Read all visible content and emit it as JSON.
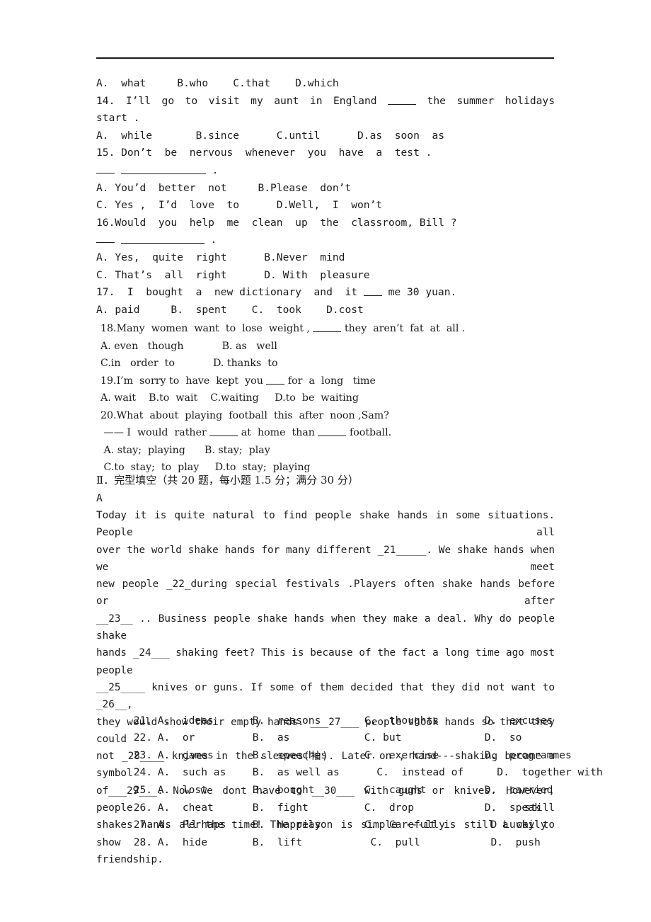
{
  "document": {
    "type": "english-exam-paper",
    "rule_visible": true
  },
  "grammar_section": {
    "q13_options_line": "A.  what     B.who    C.that    D.which",
    "q14": {
      "stem_line1": "14.  I’ll  go  to  visit  my  aunt  in  England",
      "stem_blank": "_____",
      "stem_line1_tail": "the  summer  holidays",
      "stem_line2": "start .",
      "options": "A.  while       B.since      C.until      D.as  soon  as"
    },
    "q15": {
      "stem": "15. Don’t  be  nervous  whenever  you  have  a  test .",
      "answer_line_suffix": ".",
      "options_line1": "A. You’d  better  not     B.Please  don’t",
      "options_line2": "C. Yes ,  I’d  love  to      D.Well,  I  won’t"
    },
    "q16": {
      "stem": "16.Would  you  help  me  clean  up  the  classroom, Bill ?",
      "answer_line_suffix": ".",
      "options_line1": "A. Yes,  quite  right      B.Never  mind",
      "options_line2": "C. That’s  all  right      D. With  pleasure"
    },
    "q17": {
      "stem_pre": "17.  I  bought  a  new dictionary  and  it",
      "stem_post": "me 30 yuan.",
      "options": "A. paid     B.  spent    C.  took    D.cost"
    },
    "q18": {
      "stem_pre": "18.Many  women  want  to  lose  weight ,",
      "stem_post": "they  aren’t  fat  at  all .",
      "options_line1": "A. even   though            B. as   well",
      "options_line2": "C.in   order  to            D. thanks  to"
    },
    "q19": {
      "stem_pre": "19.I’m  sorry to  have  kept  you",
      "stem_post": "for  a  long   time",
      "options": "A. wait    B.to  wait    C.waiting     D.to  be  waiting"
    },
    "q20": {
      "stem": "20.What  about  playing  football  this  after  noon ,Sam?",
      "answer_pre": "—— I  would  rather",
      "answer_mid": "at  home  than",
      "answer_post": "football.",
      "options_line1": " A. stay;  playing      B. stay;  play",
      "options_line2": " C.to  stay;  to  play     D.to  stay;  playing"
    }
  },
  "cloze_section": {
    "heading": "Ⅱ．完型填空（共 20 题，每小题 1.5 分；满分 30 分）",
    "sub_label": "A",
    "passage_lines": [
      "Today it is quite natural to find people shake hands in some situations. People all",
      "over the world shake hands for many different _21_____. We shake hands when we meet",
      "new people _22_during special festivals .Players often shake hands before or after",
      "__23__ .. Business people shake hands when they make a deal. Why do people shake",
      "hands _24___ shaking feet? This is because of the fact a long time ago most people",
      "__25____ knives or guns.  If some of them decided that they did not want to _26__,",
      "they would show their empty hands. ___27___ people shook hands so that they could",
      "not _28____  knives in the sleeves(袖). Later on , hand---shaking became a symbol",
      "of___29___.  Now we dont have to __30___ with guns or knives. However, people still",
      "shakes hands all the time! The reason is simple ---it is still a way to show",
      "friendship."
    ],
    "options": [
      {
        "num": "21.",
        "a": "A.  ideas",
        "b": "B.  reasons",
        "c": "C.  thoughts",
        "d": "D.  excuses"
      },
      {
        "num": "22.",
        "a": "A.  or",
        "b": "B.  as",
        "c": "C. but",
        "d": "D.  so"
      },
      {
        "num": "23.",
        "a": "A.  games",
        "b": "B.  speeches",
        "c": "C.  exercise",
        "d": "D.  programmes"
      },
      {
        "num": "24.",
        "a": "A.  such as",
        "b": "B.  as well as",
        "c": "  C.  instead of",
        "d": "  D.  together with"
      },
      {
        "num": "25.",
        "a": "A.  lost",
        "b": "B.  bought",
        "c": "C.  caught",
        "d": "D.  carried"
      },
      {
        "num": "26.",
        "a": "A.  cheat",
        "b": "B.  fight",
        "c": "C.  drop",
        "d": "D.  speak"
      },
      {
        "num": "27.",
        "a": "A.  Perhaps",
        "b": "B.  Happily",
        "c": "C.  Carefully",
        "d": " D Luckily"
      },
      {
        "num": "28.",
        "a": "A.  hide",
        "b": "B.  lift",
        "c": " C.  pull",
        "d": " D.  push"
      }
    ]
  }
}
